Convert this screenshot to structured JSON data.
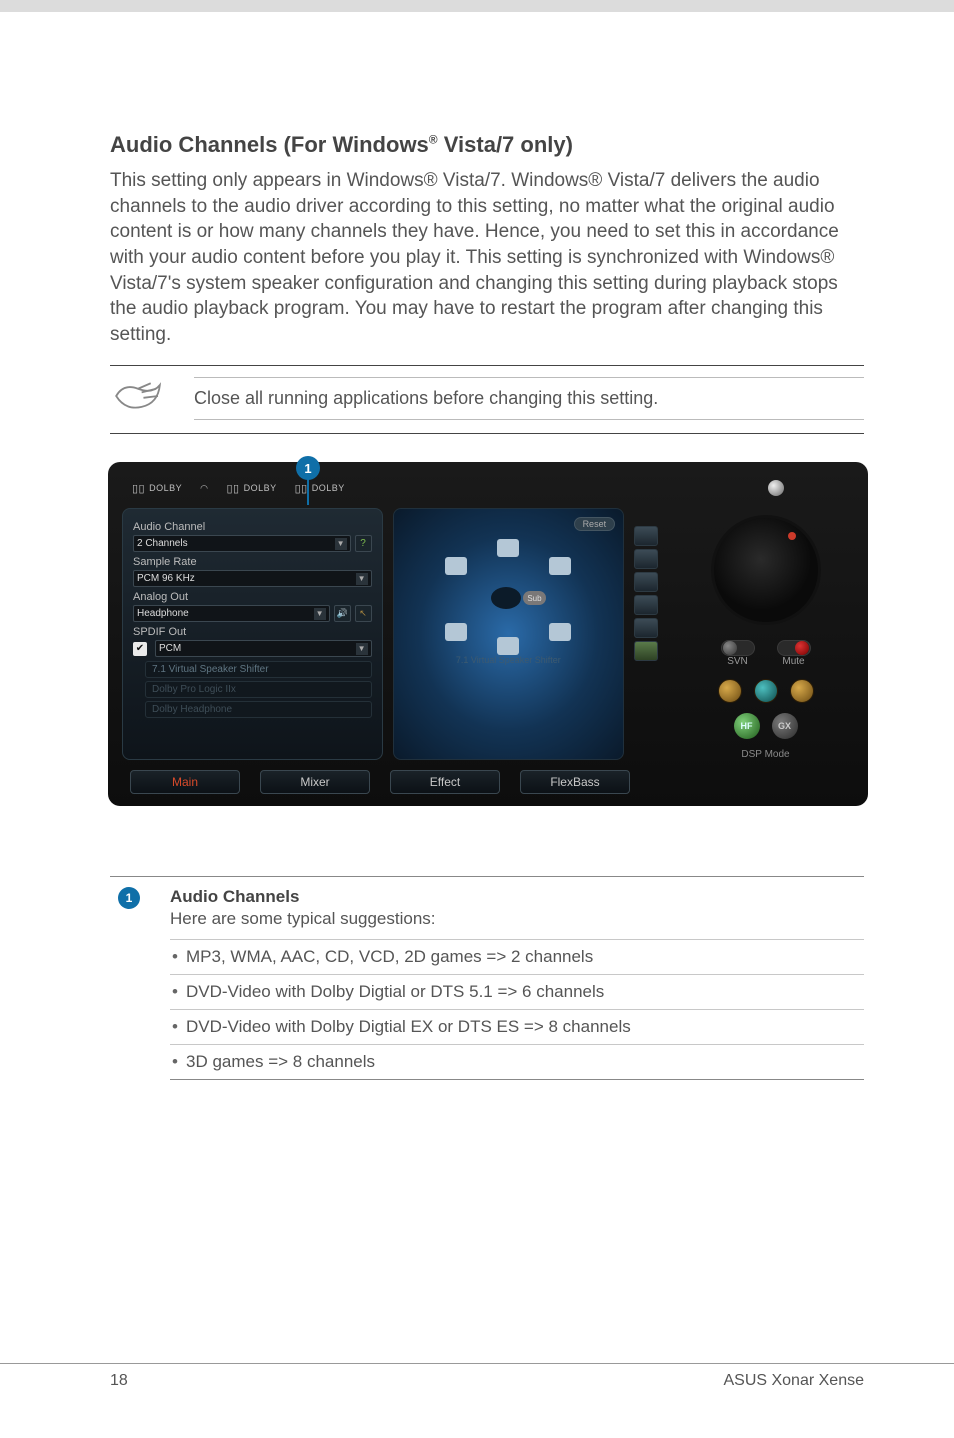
{
  "page": {
    "heading_prefix": "Audio Channels (For Windows",
    "heading_reg": "®",
    "heading_suffix": " Vista/7 only)",
    "body": "This setting only appears in Windows® Vista/7. Windows® Vista/7 delivers the audio channels to the audio driver according to this setting, no matter what the original audio content is or how many channels they have. Hence, you need to set this in accordance with your audio content before you play it. This setting is synchronized with Windows® Vista/7's system speaker configuration and changing this setting during playback stops the audio playback program. You may have to restart the program after changing this setting.",
    "note": "Close all running applications before changing this setting.",
    "page_number": "18",
    "footer_product": "ASUS Xonar Xense"
  },
  "callout": {
    "num": "1"
  },
  "panel": {
    "logos": [
      "DOLBY",
      "DOLBY",
      "DOLBY"
    ],
    "audio_channel_label": "Audio Channel",
    "audio_channel_value": "2 Channels",
    "help_glyph": "?",
    "sample_rate_label": "Sample Rate",
    "sample_rate_value": "PCM 96 KHz",
    "analog_out_label": "Analog Out",
    "analog_out_value": "Headphone",
    "spdif_out_label": "SPDIF Out",
    "spdif_out_value": "PCM",
    "spdif_checked": "✔",
    "virtual_speaker": "7.1 Virtual Speaker Shifter",
    "dolby_prologic": "Dolby Pro Logic IIx",
    "dolby_headphone": "Dolby Headphone",
    "reset": "Reset",
    "center_caption": "7.1 Virtual Speaker Shifter",
    "sub_label": "Sub",
    "tabs": {
      "main": "Main",
      "mixer": "Mixer",
      "effect": "Effect",
      "flex": "FlexBass"
    },
    "svn": "SVN",
    "mute": "Mute",
    "dsp_mode": "DSP Mode",
    "hf": "HF",
    "gx": "GX"
  },
  "desc": {
    "badge": "1",
    "title": "Audio Channels",
    "sub": "Here are some typical suggestions:",
    "items": [
      "MP3, WMA, AAC, CD, VCD, 2D games => 2 channels",
      "DVD-Video with Dolby Digtial or DTS 5.1 => 6 channels",
      "DVD-Video with Dolby Digtial EX or DTS ES => 8 channels",
      "3D games => 8 channels"
    ]
  }
}
